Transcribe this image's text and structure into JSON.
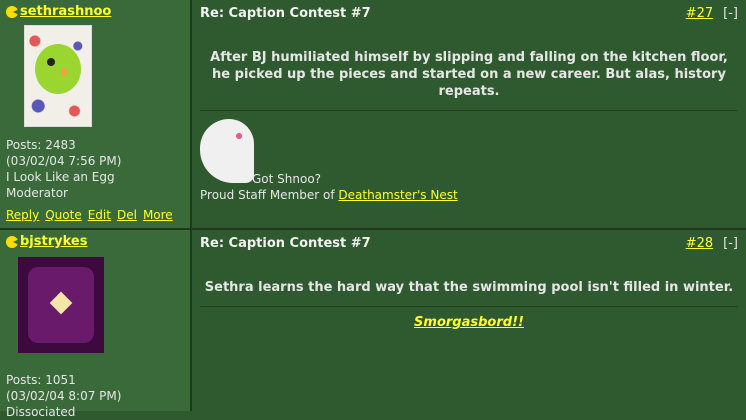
{
  "posts": [
    {
      "username": "sethrashnoo",
      "posts_label": "Posts: 2483",
      "date": "(03/02/04 7:56 PM)",
      "status_line1": "I Look Like an Egg",
      "status_line2": "Moderator",
      "actions": [
        "Reply",
        "Quote",
        "Edit",
        "Del",
        "More"
      ],
      "subject": "Re: Caption Contest #7",
      "post_number": "#27",
      "collapse": "[-]",
      "body": "After BJ humiliated himself by slipping and falling on the kitchen floor, he picked up the pieces and started on a new career. But alas, history repeats.",
      "sig_line1": "Got Shnoo?",
      "sig_prefix": "Proud Staff Member of ",
      "sig_link": "Deathamster's Nest"
    },
    {
      "username": "bjstrykes",
      "posts_label": "Posts: 1051",
      "date": "(03/02/04 8:07 PM)",
      "status_line1": "Dissociated",
      "subject": "Re: Caption Contest #7",
      "post_number": "#28",
      "collapse": "[-]",
      "body": "Sethra learns the hard way that the swimming pool isn't filled in winter.",
      "sig_link": "Smorgasbord!!"
    }
  ],
  "colors": {
    "background": "#2f5a2f",
    "sidebar": "#3a6a3a",
    "link": "#ffff33"
  }
}
